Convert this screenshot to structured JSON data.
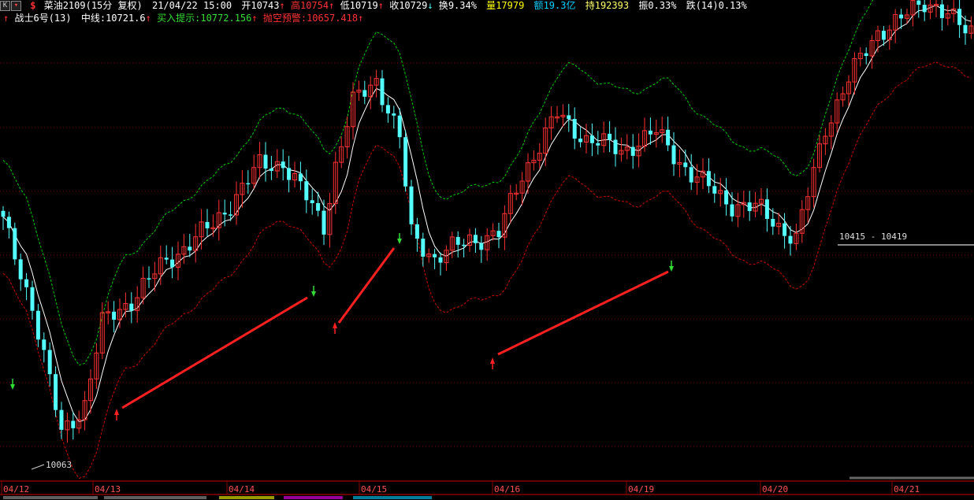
{
  "header": {
    "k_button": "K",
    "dropdown_button": "▾",
    "dollar_icon": "$",
    "symbol": "菜油2109(15分 复权)",
    "datetime": "21/04/22 15:00",
    "open_label": "开",
    "open_value": "10743",
    "high_label": "高",
    "high_value": "10754",
    "low_label": "低",
    "low_value": "10719",
    "close_label": "收",
    "close_value": "10729",
    "turnover_label": "换",
    "turnover_value": "9.34%",
    "volume_label": "量",
    "volume_value": "17979",
    "amount_label": "额",
    "amount_value": "19.3亿",
    "holding_label": "持",
    "holding_value": "192393",
    "amplitude_label": "振",
    "amplitude_value": "0.33%",
    "change_label": "跌",
    "change_value": "(14)0.13%"
  },
  "indicator": {
    "name": "战士6号(13)",
    "mid_label": "中线:",
    "mid_value": "10721.6",
    "buy_label": "买入提示:",
    "buy_value": "10772.156",
    "sell_label": "抛空预警:",
    "sell_value": "10657.418"
  },
  "colors": {
    "up": "#ff3232",
    "down": "#54ffff",
    "mid": "#ffffff",
    "upper": "#00cc00",
    "lower": "#cc0000",
    "trend": "#ff2020",
    "grid": "#8b0000",
    "volume": "#ffff00",
    "amount": "#00d0ff",
    "holding": "#ffff66"
  },
  "chart_data": {
    "type": "candlestick",
    "x_ticks": [
      "04/12",
      "04/13",
      "04/14",
      "04/15",
      "04/16",
      "04/19",
      "04/20",
      "04/21"
    ],
    "price_annotations": [
      {
        "text": "10063"
      },
      {
        "text": "10415 - 10419"
      }
    ],
    "series": [
      {
        "name": "中线"
      },
      {
        "name": "买入提示"
      },
      {
        "name": "抛空预警"
      }
    ]
  }
}
